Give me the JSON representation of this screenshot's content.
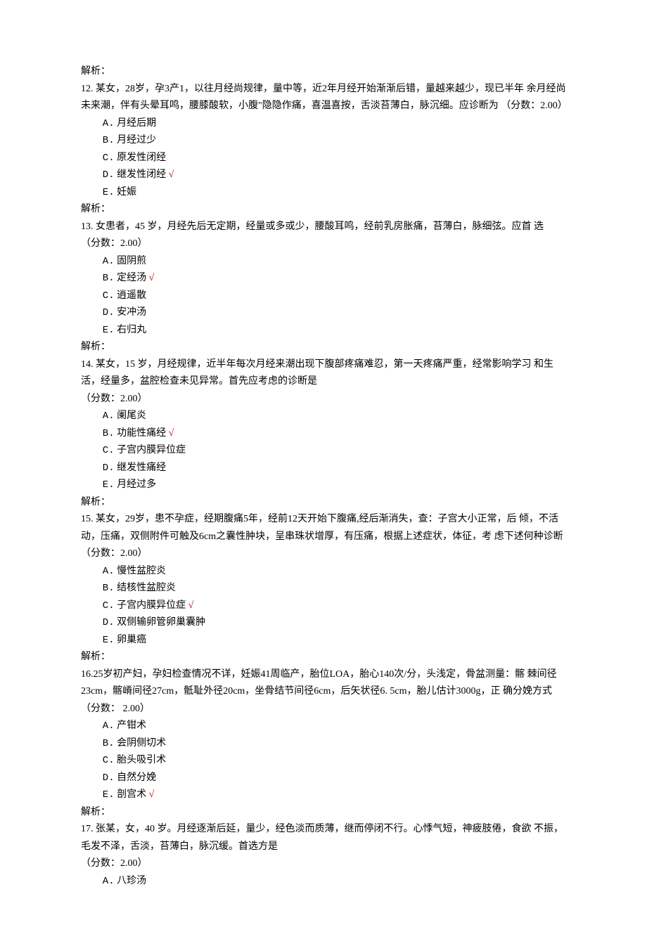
{
  "q11": {
    "analysis": "解析："
  },
  "q12": {
    "stem": "12. 某女，28岁，孕3产1，以往月经尚规律，量中等，近2年月经开始渐渐后错，量越来越少，现已半年 余月经尚未来潮，伴有头晕耳鸣，腰膝酸软，小腹\"隐隐作痛，喜温喜按，舌淡苔薄白，脉沉细。应诊断为 （分数：2.00）",
    "a": "月经后期",
    "b": "月经过少",
    "c": "原发性闭经",
    "d": "继发性闭经",
    "e": "妊娠",
    "analysis": "解析："
  },
  "q13": {
    "stem": "13. 女患者，45 岁，月经先后无定期，经量或多或少，腰酸耳鸣，经前乳房胀痛，苔薄白，脉细弦。应首 选",
    "score": "（分数：2.00）",
    "a": "固阴煎",
    "b": "定经汤",
    "c": "逍遥散",
    "d": "安冲汤",
    "e": "右归丸",
    "analysis": "解析："
  },
  "q14": {
    "stem": "14. 某女，15 岁，月经规律，近半年每次月经来潮出现下腹部疼痛难忍，第一天疼痛严重，经常影响学习 和生活，经量多，盆腔检查未见异常。首先应考虑的诊断是",
    "score": "（分数：2.00）",
    "a": "阑尾炎",
    "b": "功能性痛经",
    "c": "子宫内膜异位症",
    "d": "继发性痛经",
    "e": "月经过多",
    "analysis": "解析："
  },
  "q15": {
    "stem": "15. 某女，29岁，患不孕症，经期腹痛5年，经前12天开始下腹痛,经后渐消失，查：子宫大小正常，后 倾，不活动，压痛，双侧附件可触及6cm之囊性肿块，呈串珠状增厚，有压痛，根据上述症状，体征，考 虑下述何种诊断",
    "score": "（分数：2.00）",
    "a": "慢性盆腔炎",
    "b": "结核性盆腔炎",
    "c": "子宫内膜异位症",
    "d": "双侧输卵管卵巢囊肿",
    "e": "卵巢癌",
    "analysis": "解析："
  },
  "q16": {
    "stem": "16.25岁初产妇，孕妇检查情况不详，妊娠41周临产，胎位LOA，胎心140次/分，头浅定，骨盆测量：髂 棘间径23cm，髂嵴间径27cm，骶耻外径20cm，坐骨结节间径6cm，后矢状径6. 5cm，胎儿估计3000g，正 确分娩方式",
    "score": "（分数： 2.00）",
    "a": "产钳术",
    "b": "会阴侧切术",
    "c": "胎头吸引术",
    "d": "自然分娩",
    "e": "剖宫术",
    "analysis": "解析："
  },
  "q17": {
    "stem": "17. 张某，女，40 岁。月经逐渐后延，量少，经色淡而质薄，继而停闭不行。心悸气短，神疲肢倦，食欲 不振，毛发不泽，舌淡，苔薄白，脉沉缓。首选方是",
    "score": "（分数：2.00）",
    "a": "八珍汤"
  },
  "labels": {
    "a": "A.",
    "b": "B.",
    "c": "C.",
    "d": "D.",
    "e": "E."
  },
  "check": "√"
}
